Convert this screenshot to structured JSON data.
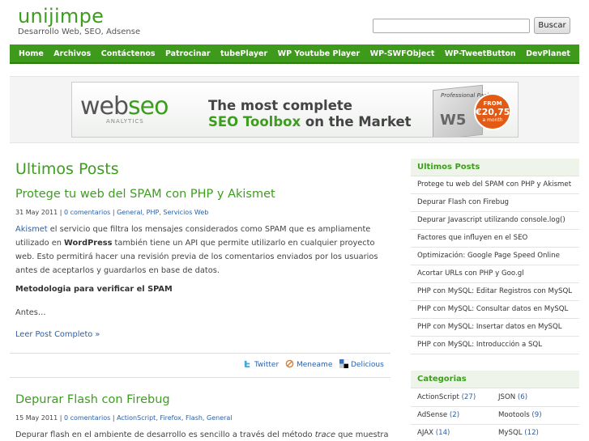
{
  "header": {
    "title": "unijimpe",
    "description": "Desarrollo Web, SEO, Adsense",
    "search_placeholder": "",
    "search_button": "Buscar"
  },
  "nav": [
    "Home",
    "Archivos",
    "Contáctenos",
    "Patrocinar",
    "tubePlayer",
    "WP Youtube Player",
    "WP-SWFObject",
    "WP-TweetButton",
    "DevPlanet"
  ],
  "banner": {
    "logo_web": "web",
    "logo_seo": "seo",
    "logo_sub": "ANALYTICS",
    "line1": "The most complete",
    "line2_highlight": "SEO Toolbox",
    "line2_rest": " on the Market",
    "box_label": "Professional Pack",
    "box_mark": "W5",
    "price_from": "FROM",
    "price_amount": "€20,75",
    "price_period": "a month"
  },
  "main": {
    "heading": "Ultimos Posts",
    "posts": [
      {
        "title": "Protege tu web del SPAM con PHP y Akismet",
        "date": "31 May 2011",
        "comments": "0 comentarios",
        "categories": "General, PHP, Servicios Web",
        "p1_link": "Akismet",
        "p1_a": " el servicio que filtra los mensajes considerados como SPAM que es ampliamente utilizado en ",
        "p1_bold": "WordPress",
        "p1_b": " también tiene un API que permite utilizarlo en cualquier proyecto web. Esto permitirá hacer una revisión previa de los comentarios enviados por los usuarios antes de aceptarlos y guardarlos en base de datos.",
        "subheading": "Metodologia para verificar el SPAM",
        "tail": "Antes…",
        "read_more": "Leer Post Completo »"
      },
      {
        "title": "Depurar Flash con Firebug",
        "date": "15 May 2011",
        "comments": "0 comentarios",
        "categories": "ActionScript, Firefox, Flash, General",
        "p1_a": "Depurar flash en el ambiente de desarrollo es sencillo a través del método ",
        "p1_em": "trace",
        "p1_b": " que muestra"
      }
    ],
    "share": {
      "twitter": "Twitter",
      "meneame": "Meneame",
      "delicious": "Delicious"
    }
  },
  "sidebar": {
    "recent_heading": "Ultimos Posts",
    "recent": [
      "Protege tu web del SPAM con PHP y Akismet",
      "Depurar Flash con Firebug",
      "Depurar Javascript utilizando console.log()",
      "Factores que influyen en el SEO",
      "Optimización: Google Page Speed Online",
      "Acortar URLs con PHP y Goo.gl",
      "PHP con MySQL: Editar Registros con MySQL",
      "PHP con MySQL: Consultar datos en MySQL",
      "PHP con MySQL: Insertar datos en MySQL",
      "PHP con MySQL: Introducción a SQL"
    ],
    "categories_heading": "Categorias",
    "categories": [
      {
        "name": "ActionScript",
        "count": "(27)"
      },
      {
        "name": "JSON",
        "count": "(6)"
      },
      {
        "name": "AdSense",
        "count": "(2)"
      },
      {
        "name": "Mootools",
        "count": "(9)"
      },
      {
        "name": "AJAX",
        "count": "(14)"
      },
      {
        "name": "MySQL",
        "count": "(12)"
      }
    ]
  },
  "colors": {
    "brand_green": "#3d9d1f",
    "link_blue": "#2b5fa8",
    "price_orange": "#e25a14"
  }
}
